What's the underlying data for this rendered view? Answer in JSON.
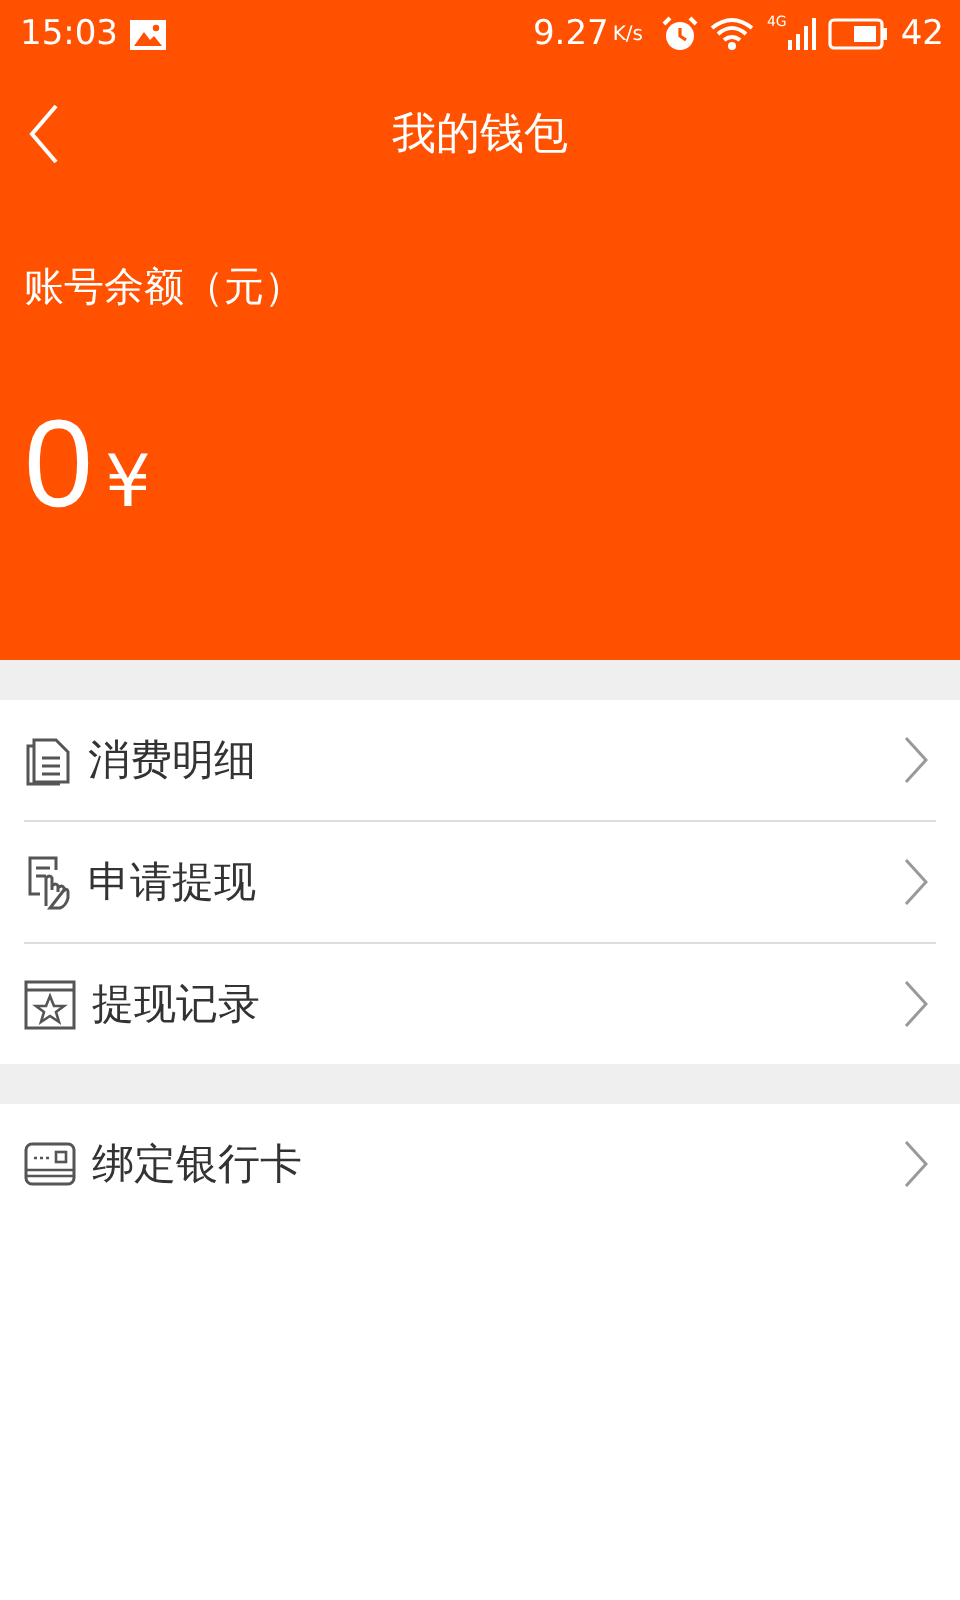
{
  "status_bar": {
    "time": "15:03",
    "speed": "9.27",
    "speed_unit": "K/s",
    "network": "4G",
    "battery": "42"
  },
  "header": {
    "title": "我的钱包"
  },
  "balance": {
    "label": "账号余额（元）",
    "amount": "0",
    "currency": "¥"
  },
  "menu_groups": [
    {
      "items": [
        {
          "label": "消费明细",
          "kind": "document"
        },
        {
          "label": "申请提现",
          "kind": "hand"
        },
        {
          "label": "提现记录",
          "kind": "star"
        }
      ]
    },
    {
      "items": [
        {
          "label": "绑定银行卡",
          "kind": "card"
        }
      ]
    }
  ]
}
